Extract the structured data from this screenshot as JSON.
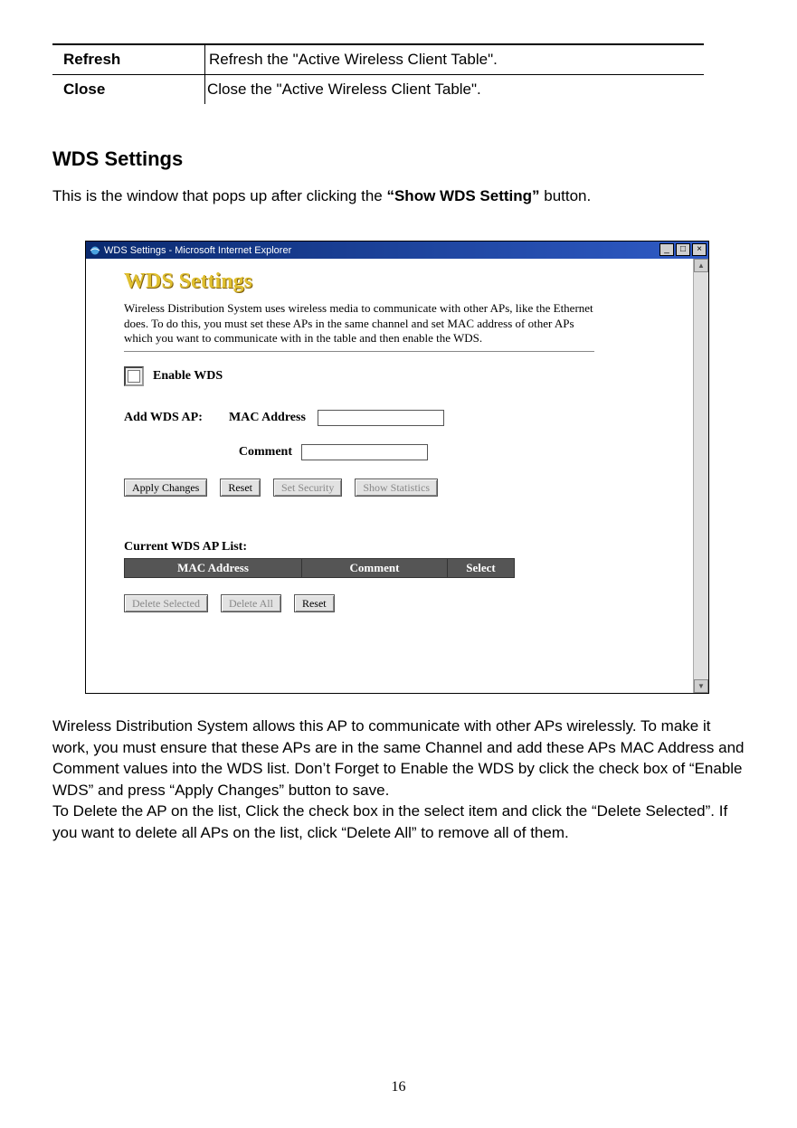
{
  "top_table": {
    "rows": [
      {
        "label": "Refresh",
        "desc": "Refresh the \"Active Wireless Client Table\"."
      },
      {
        "label": "Close",
        "desc": "Close the \"Active Wireless Client Table\"."
      }
    ]
  },
  "section_heading": "WDS Settings",
  "intro": {
    "pre": "This is the window that pops up after clicking the ",
    "bold": "“Show WDS Setting”",
    "post": " button."
  },
  "ie": {
    "title": "WDS Settings - Microsoft Internet Explorer",
    "winbtns": {
      "min": "_",
      "max": "□",
      "close": "×"
    },
    "content": {
      "heading": "WDS Settings",
      "desc": "Wireless Distribution System uses wireless media to communicate with other APs, like the Ethernet does. To do this, you must set these APs in the same channel and set MAC address of other APs which you want to communicate with in the table and then enable the WDS.",
      "enable_label": "Enable WDS",
      "add_label": "Add WDS AP:",
      "mac_label": "MAC Address",
      "comment_label": "Comment",
      "buttons": {
        "apply": "Apply Changes",
        "reset1": "Reset",
        "set_security": "Set Security",
        "show_stats": "Show Statistics"
      },
      "list_title": "Current WDS AP List:",
      "cols": {
        "mac": "MAC Address",
        "comment": "Comment",
        "select": "Select"
      },
      "lower_buttons": {
        "delete_selected": "Delete Selected",
        "delete_all": "Delete All",
        "reset2": "Reset"
      }
    }
  },
  "after1": "Wireless Distribution System allows this AP to communicate with other APs wirelessly. To make it work, you must ensure that these APs are in the same Channel and add these APs MAC Address and Comment values into the WDS list. Don’t Forget to Enable the WDS by click the check box of “Enable WDS” and press “Apply Changes” button to save.",
  "after2": "To Delete the AP on the list, Click the check box in the select item and click the “Delete Selected”. If you want to delete all APs on the list, click “Delete All” to remove all of them.",
  "page_number": "16"
}
